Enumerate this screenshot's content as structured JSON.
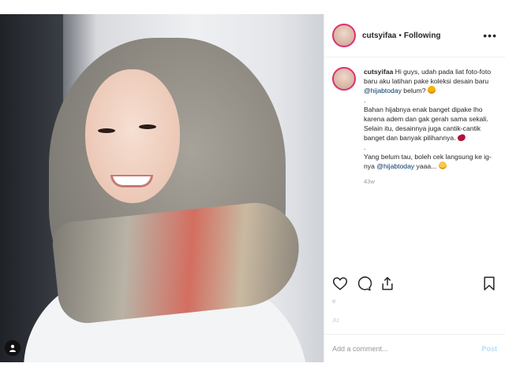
{
  "post": {
    "username": "cutsyifaa",
    "separator": "•",
    "follow_label": "Following",
    "more_icon": "more-icon",
    "caption": {
      "username": "cutsyifaa",
      "line1": " Hi guys, udah pada liat foto-foto baru aku latihan pake koleksi desain baru ",
      "mention1": "@hijabtoday",
      "line1_end": " belum? ",
      "dot1": ".",
      "para2": "Bahan hijabnya enak banget dipake lho karena adem dan gak gerah sama sekali. Selain itu, desainnya juga cantik-cantik banget dan banyak pilihannya. ",
      "dot2": ".",
      "para3_start": "Yang belum tau, boleh cek langsung ke ig-nya ",
      "mention2": "@hijabtoday",
      "para3_end": " yaaa... "
    },
    "time_ago": "43w",
    "faint_row": "e",
    "faint_date": "JU"
  },
  "actions": {
    "like_icon": "heart-icon",
    "comment_icon": "comment-icon",
    "share_icon": "share-icon",
    "save_icon": "bookmark-icon"
  },
  "comment_box": {
    "placeholder": "Add a comment...",
    "post_label": "Post"
  },
  "colors": {
    "story_ring": "#e1306c",
    "mention": "#003569",
    "post_disabled": "#b2dffc",
    "muted": "#999999"
  }
}
